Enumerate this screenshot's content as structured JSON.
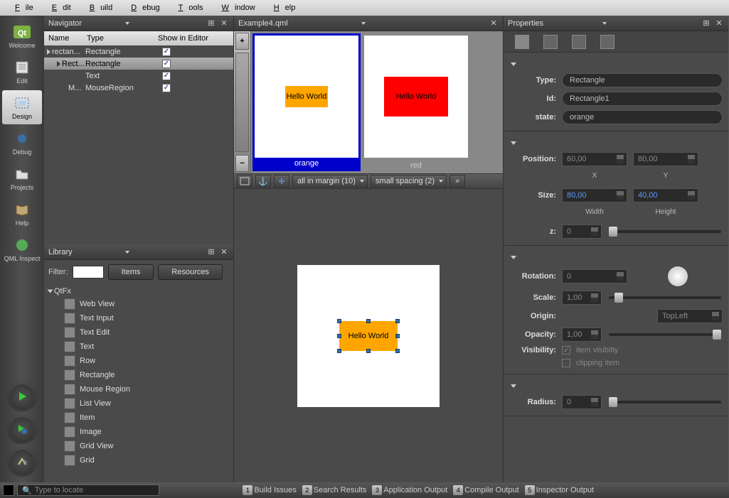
{
  "menu": [
    "File",
    "Edit",
    "Build",
    "Debug",
    "Tools",
    "Window",
    "Help"
  ],
  "sidebar": {
    "welcome": "Welcome",
    "edit": "Edit",
    "design": "Design",
    "debug": "Debug",
    "projects": "Projects",
    "help": "Help",
    "qmlinspect": "QML Inspect"
  },
  "navigator": {
    "title": "Navigator",
    "cols": {
      "name": "Name",
      "type": "Type",
      "show": "Show in Editor"
    },
    "rows": [
      {
        "indent": 4,
        "expand": true,
        "name": "rectan...",
        "type": "Rectangle",
        "selected": false
      },
      {
        "indent": 18,
        "expand": true,
        "name": "Rect...",
        "type": "Rectangle",
        "selected": true
      },
      {
        "indent": 34,
        "expand": false,
        "name": "",
        "type": "Text",
        "selected": false
      },
      {
        "indent": 34,
        "expand": false,
        "name": "M...",
        "type": "MouseRegion",
        "selected": false
      }
    ]
  },
  "library": {
    "title": "Library",
    "filter_label": "Filter:",
    "items_tab": "Items",
    "resources_tab": "Resources",
    "category": "QtFx",
    "items": [
      "Web View",
      "Text Input",
      "Text Edit",
      "Text",
      "Row",
      "Rectangle",
      "Mouse Region",
      "List View",
      "Item",
      "Image",
      "Grid View",
      "Grid"
    ]
  },
  "center": {
    "doc_title": "Example4.qml",
    "state1": "orange",
    "state2": "red",
    "hello": "Hello World",
    "margin_combo": "all in margin (10)",
    "spacing_combo": "small spacing (2)"
  },
  "properties": {
    "title": "Properties",
    "type_label": "Type:",
    "type_val": "Rectangle",
    "id_label": "Id:",
    "id_val": "Rectangle1",
    "state_label": "state:",
    "state_val": "orange",
    "position_label": "Position:",
    "pos_x": "60,00",
    "pos_y": "80,00",
    "x_label": "X",
    "y_label": "Y",
    "size_label": "Size:",
    "width_val": "80,00",
    "height_val": "40,00",
    "width_label": "Width",
    "height_label": "Height",
    "z_label": "z:",
    "z_val": "0",
    "rotation_label": "Rotation:",
    "rotation_val": "0",
    "scale_label": "Scale:",
    "scale_val": "1,00",
    "origin_label": "Origin:",
    "origin_val": "TopLeft",
    "opacity_label": "Opacity:",
    "opacity_val": "1,00",
    "visibility_label": "Visibility:",
    "vis_cb1": "item visibilty",
    "vis_cb2": "clipping item",
    "radius_label": "Radius:",
    "radius_val": "0"
  },
  "statusbar": {
    "placeholder": "Type to locate",
    "t1": "Build Issues",
    "t2": "Search Results",
    "t3": "Application Output",
    "t4": "Compile Output",
    "t5": "Inspector Output"
  }
}
